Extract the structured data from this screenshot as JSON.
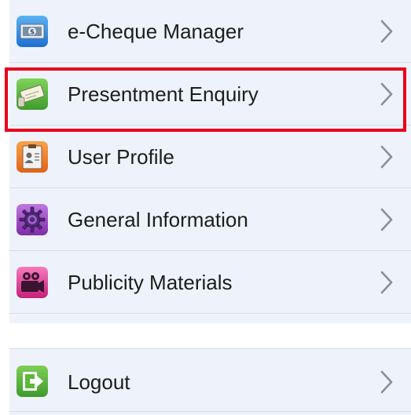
{
  "menu": {
    "items": [
      {
        "label": "e-Cheque Manager",
        "icon": "cheque-icon",
        "icon_color": "#2f7fd6"
      },
      {
        "label": "Presentment Enquiry",
        "icon": "presentment-icon",
        "icon_color": "#4fae3a",
        "highlighted": true
      },
      {
        "label": "User Profile",
        "icon": "user-profile-icon",
        "icon_color": "#ef7a22"
      },
      {
        "label": "General Information",
        "icon": "gear-icon",
        "icon_color": "#9b3fc1"
      },
      {
        "label": "Publicity Materials",
        "icon": "video-camera-icon",
        "icon_color": "#e0398e"
      }
    ]
  },
  "logout": {
    "label": "Logout",
    "icon": "logout-icon",
    "icon_color": "#5cb83a"
  },
  "colors": {
    "background": "#ffffff",
    "row_background": "#eef3fb",
    "divider": "#d6dbe4",
    "text": "#1d1d1d",
    "chevron": "#8a8f97",
    "highlight": "#e8001c"
  }
}
